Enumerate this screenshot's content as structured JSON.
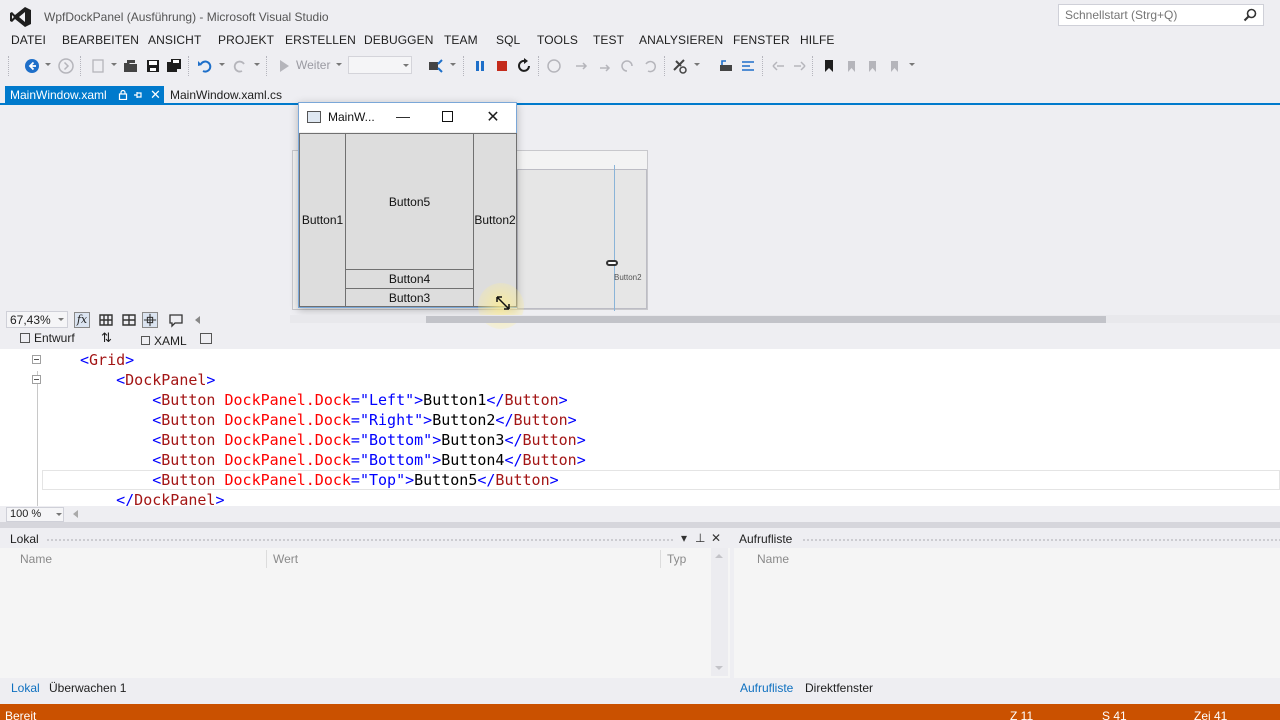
{
  "window": {
    "title": "WpfDockPanel (Ausführung) - Microsoft Visual Studio",
    "quicklaunch_placeholder": "Schnellstart (Strg+Q)"
  },
  "menu": {
    "items": [
      "DATEI",
      "BEARBEITEN",
      "ANSICHT",
      "PROJEKT",
      "ERSTELLEN",
      "DEBUGGEN",
      "TEAM",
      "SQL",
      "TOOLS",
      "TEST",
      "ANALYSIEREN",
      "FENSTER",
      "HILFE"
    ]
  },
  "toolbar": {
    "continue_label": "Weiter",
    "debug_target_value": ""
  },
  "doc_tabs": {
    "active": "MainWindow.xaml",
    "inactive": "MainWindow.xaml.cs",
    "close_glyph": "✕"
  },
  "running_window": {
    "title": "MainW...",
    "buttons": {
      "left": "Button1",
      "right": "Button2",
      "top": "Button5",
      "bottom1": "Button4",
      "bottom2": "Button3"
    }
  },
  "designer": {
    "zoom": "67,43%",
    "preview_label": "Button2",
    "fx_label": "fx"
  },
  "split": {
    "design_tab": "Entwurf",
    "xaml_tab": "XAML",
    "swap_glyph": "⇅"
  },
  "code": {
    "lines": [
      {
        "indent": 1,
        "tokens": [
          [
            "b",
            "<"
          ],
          [
            "t",
            "Grid"
          ],
          [
            "b",
            ">"
          ]
        ]
      },
      {
        "indent": 2,
        "tokens": [
          [
            "b",
            "<"
          ],
          [
            "t",
            "DockPanel"
          ],
          [
            "b",
            ">"
          ]
        ]
      },
      {
        "indent": 3,
        "tokens": [
          [
            "b",
            "<"
          ],
          [
            "t",
            "Button"
          ],
          [
            "x",
            " "
          ],
          [
            "a",
            "DockPanel.Dock"
          ],
          [
            "b",
            "="
          ],
          [
            "v",
            "\"Left\""
          ],
          [
            "b",
            ">"
          ],
          [
            "x",
            "Button1"
          ],
          [
            "b",
            "</"
          ],
          [
            "t",
            "Button"
          ],
          [
            "b",
            ">"
          ]
        ]
      },
      {
        "indent": 3,
        "tokens": [
          [
            "b",
            "<"
          ],
          [
            "t",
            "Button"
          ],
          [
            "x",
            " "
          ],
          [
            "a",
            "DockPanel.Dock"
          ],
          [
            "b",
            "="
          ],
          [
            "v",
            "\"Right\""
          ],
          [
            "b",
            ">"
          ],
          [
            "x",
            "Button2"
          ],
          [
            "b",
            "</"
          ],
          [
            "t",
            "Button"
          ],
          [
            "b",
            ">"
          ]
        ]
      },
      {
        "indent": 3,
        "tokens": [
          [
            "b",
            "<"
          ],
          [
            "t",
            "Button"
          ],
          [
            "x",
            " "
          ],
          [
            "a",
            "DockPanel.Dock"
          ],
          [
            "b",
            "="
          ],
          [
            "v",
            "\"Bottom\""
          ],
          [
            "b",
            ">"
          ],
          [
            "x",
            "Button3"
          ],
          [
            "b",
            "</"
          ],
          [
            "t",
            "Button"
          ],
          [
            "b",
            ">"
          ]
        ]
      },
      {
        "indent": 3,
        "tokens": [
          [
            "b",
            "<"
          ],
          [
            "t",
            "Button"
          ],
          [
            "x",
            " "
          ],
          [
            "a",
            "DockPanel.Dock"
          ],
          [
            "b",
            "="
          ],
          [
            "v",
            "\"Bottom\""
          ],
          [
            "b",
            ">"
          ],
          [
            "x",
            "Button4"
          ],
          [
            "b",
            "</"
          ],
          [
            "t",
            "Button"
          ],
          [
            "b",
            ">"
          ]
        ]
      },
      {
        "indent": 3,
        "tokens": [
          [
            "b",
            "<"
          ],
          [
            "t",
            "Button"
          ],
          [
            "x",
            " "
          ],
          [
            "a",
            "DockPanel.Dock"
          ],
          [
            "b",
            "="
          ],
          [
            "v",
            "\"Top\""
          ],
          [
            "b",
            ">"
          ],
          [
            "x",
            "Button5"
          ],
          [
            "b",
            "</"
          ],
          [
            "t",
            "Button"
          ],
          [
            "b",
            ">"
          ]
        ]
      },
      {
        "indent": 2,
        "tokens": [
          [
            "b",
            "</"
          ],
          [
            "t",
            "DockPanel"
          ],
          [
            "b",
            ">"
          ]
        ]
      }
    ],
    "zoom": "100 %"
  },
  "locals_pane": {
    "title": "Lokal",
    "columns": [
      "Name",
      "Wert",
      "Typ"
    ]
  },
  "callstack_pane": {
    "title": "Aufrufliste",
    "columns": [
      "Name"
    ]
  },
  "pane_tabs": {
    "left": [
      "Lokal",
      "Überwachen 1"
    ],
    "right": [
      "Aufrufliste",
      "Direktfenster"
    ]
  },
  "status": {
    "left": "Bereit",
    "line": "Z 11",
    "col": "S 41",
    "char": "Zei 41"
  },
  "colors": {
    "accent": "#007acc",
    "status_debug": "#ca5100",
    "xml_tag": "#a31515",
    "xml_attr": "#ff0000",
    "xml_value": "#0000ff"
  }
}
